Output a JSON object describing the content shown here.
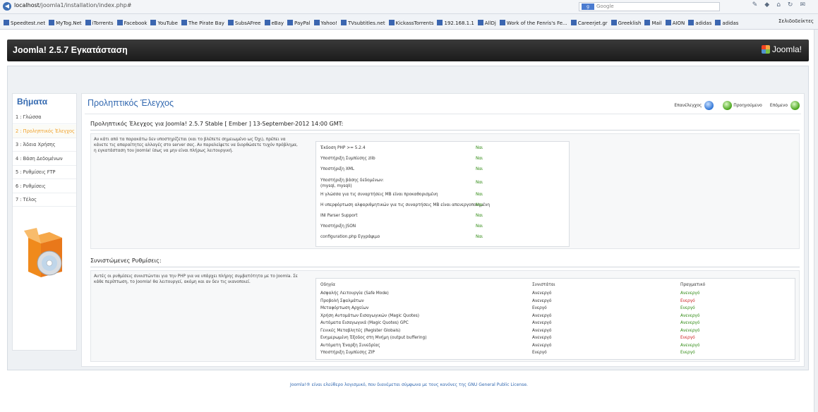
{
  "browser": {
    "url_host": "localhost",
    "url_path": "/joomla1/installation/index.php#",
    "search_engine": "Google",
    "bookmarks": [
      "Speedtest.net",
      "MyTog.Net",
      "iTorrents",
      "Facebook",
      "YouTube",
      "The Pirate Bay",
      "SubsAFree",
      "eBay",
      "PayPal",
      "Yahoo!",
      "TVsubtitles.net",
      "KickassTorrents",
      "192.168.1.1",
      "AllDj",
      "Work of the Fenris's Fe...",
      "Careerjet.gr",
      "Greeklish",
      "Mail",
      "AION",
      "adidas",
      "adidas"
    ],
    "bookmarks_right": "Σελιδοδείκτες"
  },
  "header": {
    "title": "Joomla! 2.5.7 Εγκατάσταση",
    "logo_text": "Joomla!"
  },
  "sidebar": {
    "title": "Βήματα",
    "items": [
      {
        "label": "1 : Γλώσσα"
      },
      {
        "label": "2 : Προληπτικός Έλεγχος"
      },
      {
        "label": "3 : Άδεια Χρήσης"
      },
      {
        "label": "4 : Βάση Δεδομένων"
      },
      {
        "label": "5 : Ρυθμίσεις FTP"
      },
      {
        "label": "6 : Ρυθμίσεις"
      },
      {
        "label": "7 : Τέλος"
      }
    ]
  },
  "main": {
    "title": "Προληπτικός Έλεγχος",
    "buttons": {
      "refresh": "Επανέλεγχος",
      "previous": "Προηγούμενο",
      "next": "Επόμενο"
    },
    "precheck": {
      "heading": "Προληπτικός Έλεγχος για Joomla! 2.5.7 Stable [ Ember ] 13-September-2012 14:00 GMT:",
      "description": "Αν κάτι από τα παρακάτω δεν υποστηρίζεται (και το βλέπετε σημειωμένο ως Όχι), πρέπει να κάνετε τις απαραίτητες αλλαγές στο server σας. Αν παραλείψετε να διορθώσετε τυχόν πρόβλημα, η εγκατάσταση του Joomla! ίσως να μην είναι πλήρως λειτουργική.",
      "rows": [
        {
          "label": "Έκδοση PHP >= 5.2.4",
          "value": "Ναι"
        },
        {
          "label": "Υποστήριξη Συμπίεσης zlib",
          "value": "Ναι"
        },
        {
          "label": "Υποστήριξη XML",
          "value": "Ναι"
        },
        {
          "label": "Υποστήριξη βάσης δεδομένων: (mysql, mysqli)",
          "value": "Ναι"
        },
        {
          "label": "Η γλώσσα για τις συναρτήσεις MB είναι προκαθορισμένη",
          "value": "Ναι"
        },
        {
          "label": "Η υπερφόρτωση αλφαριθμητικών για τις συναρτήσεις MB είναι απενεργοποιημένη",
          "value": "Ναι"
        },
        {
          "label": "INI Parser Support",
          "value": "Ναι"
        },
        {
          "label": "Υποστήριξη JSON",
          "value": "Ναι"
        },
        {
          "label": "configuration.php Εγγράψιμο",
          "value": "Ναι"
        }
      ]
    },
    "recommended": {
      "heading": "Συνιστώμενες Ρυθμίσεις:",
      "description": "Αυτές οι ρυθμίσεις συνιστώνται για την PHP για να υπάρχει πλήρης συμβατότητα με το Joomla. Σε κάθε περίπτωση, το Joomla! θα λειτουργεί, ακόμη και αν δεν τις ικανοποιεί.",
      "columns": [
        "Οδηγία",
        "Συνιστάται",
        "Πραγματικό"
      ],
      "rows": [
        {
          "directive": "Ασφαλής Λειτουργία (Safe Mode)",
          "recommended": "Ανενεργό",
          "actual": "Ανενεργό",
          "ok": true
        },
        {
          "directive": "Προβολή Σφαλμάτων",
          "recommended": "Ανενεργό",
          "actual": "Ενεργό",
          "ok": false
        },
        {
          "directive": "Μεταφόρτωση Αρχείων",
          "recommended": "Ενεργό",
          "actual": "Ενεργό",
          "ok": true
        },
        {
          "directive": "Χρήση Αυτομάτων Εισαγωγικών (Magic Quotes)",
          "recommended": "Ανενεργό",
          "actual": "Ανενεργό",
          "ok": true
        },
        {
          "directive": "Αυτόματα Εισαγωγικά (Magic Quotes) GPC",
          "recommended": "Ανενεργό",
          "actual": "Ανενεργό",
          "ok": true
        },
        {
          "directive": "Γενικές Μεταβλητές (Register Globals)",
          "recommended": "Ανενεργό",
          "actual": "Ανενεργό",
          "ok": true
        },
        {
          "directive": "Ενημερωμένη Έξοδος στη Μνήμη (output buffering)",
          "recommended": "Ανενεργό",
          "actual": "Ενεργό",
          "ok": false
        },
        {
          "directive": "Αυτόματη Έναρξη Συνεδρίας",
          "recommended": "Ανενεργό",
          "actual": "Ανενεργό",
          "ok": true
        },
        {
          "directive": "Υποστήριξη Συμπίεσης ZIP",
          "recommended": "Ενεργό",
          "actual": "Ενεργό",
          "ok": true
        }
      ]
    }
  },
  "footer": {
    "text": "Joomla!® είναι ελεύθερο λογισμικό, που διανέμεται σύμφωνα με τους κανόνες της GNU General Public License."
  },
  "colors": {
    "accent": "#3369b0",
    "ok": "#2f8a12",
    "bad": "#cc2222",
    "active_step": "#f0a12b"
  }
}
